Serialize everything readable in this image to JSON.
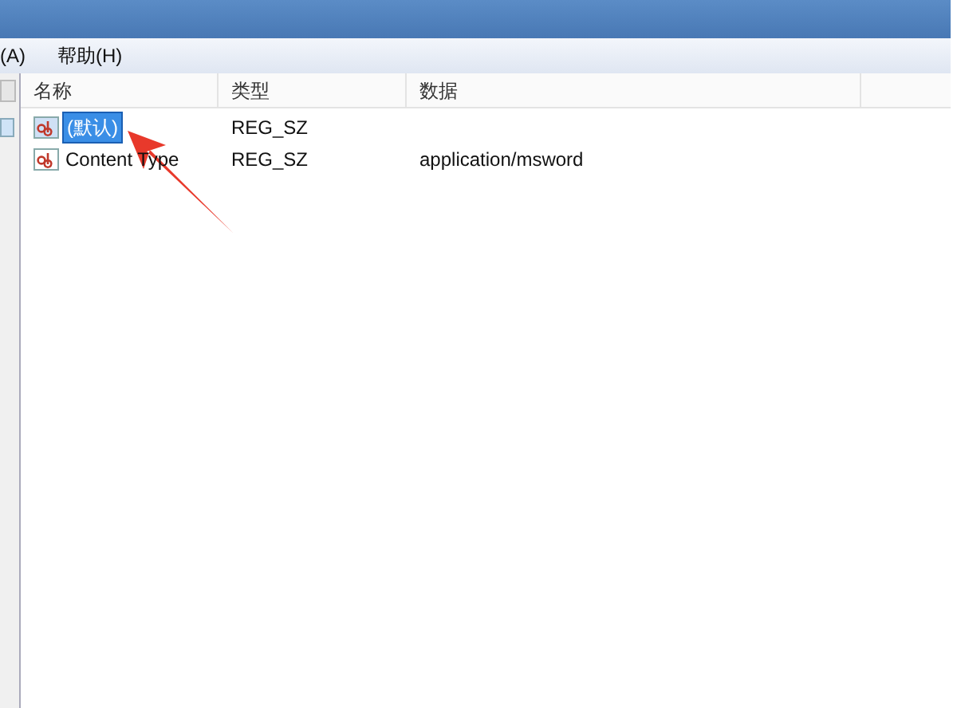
{
  "menu_bar": {
    "items": [
      "(A)",
      "帮助(H)"
    ]
  },
  "table": {
    "columns": [
      "名称",
      "类型",
      "数据"
    ],
    "rows": [
      {
        "name": "(默认)",
        "type": "REG_SZ",
        "data": "",
        "selected": true
      },
      {
        "name": "Content Type",
        "type": "REG_SZ",
        "data": "application/msword",
        "selected": false
      }
    ]
  }
}
